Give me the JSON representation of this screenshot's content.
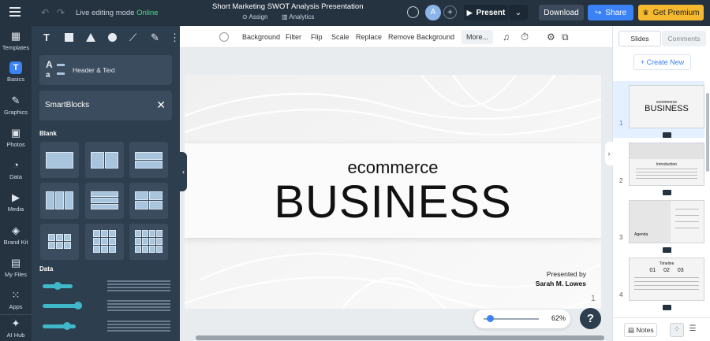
{
  "topbar": {
    "undo_icon": "undo-icon",
    "redo_icon": "redo-icon",
    "edit_mode_label": "Live editing mode",
    "edit_mode_status": "Online",
    "doc_title": "Short Marketing SWOT Analysis Presentation",
    "assign_label": "Assign",
    "analytics_label": "Analytics",
    "avatar_letter": "A",
    "present_label": "Present",
    "download_label": "Download",
    "share_label": "Share",
    "premium_label": "Get Premium",
    "accent": "#3b82f6",
    "premium_color": "#f5b82e"
  },
  "leftnav": {
    "items": [
      {
        "label": "Templates",
        "icon": "templates-icon"
      },
      {
        "label": "Basics",
        "icon": "text-icon",
        "active": true
      },
      {
        "label": "Graphics",
        "icon": "graphics-icon"
      },
      {
        "label": "Photos",
        "icon": "photos-icon"
      },
      {
        "label": "Data",
        "icon": "data-icon"
      },
      {
        "label": "Media",
        "icon": "media-icon"
      },
      {
        "label": "Brand Kit",
        "icon": "brand-kit-icon"
      },
      {
        "label": "My Files",
        "icon": "my-files-icon"
      },
      {
        "label": "Apps",
        "icon": "apps-icon"
      },
      {
        "label": "AI Hub",
        "icon": "ai-hub-icon"
      }
    ]
  },
  "panel": {
    "header_text_label": "Header & Text",
    "smartblocks_label": "SmartBlocks",
    "blank_title": "Blank",
    "data_title": "Data"
  },
  "canvas_toolbar": {
    "items": [
      "Background",
      "Filter",
      "Flip",
      "Scale",
      "Replace",
      "Remove Background"
    ],
    "more_label": "More..."
  },
  "slide": {
    "subtitle": "ecommerce",
    "title": "BUSINESS",
    "presented_by": "Presented by",
    "presenter": "Sarah M. Lowes",
    "page_number": "1"
  },
  "zoom": {
    "value": "62%",
    "level_fraction": 0.05
  },
  "help_label": "?",
  "right_panel": {
    "tab_slides": "Slides",
    "tab_comments": "Comments",
    "create_new": "+ Create New",
    "thumbs": [
      {
        "num": "1",
        "line1": "ecommerce",
        "line2": "BUSINESS"
      },
      {
        "num": "2",
        "line1": "Introduction",
        "line2": ""
      },
      {
        "num": "3",
        "line1": "Agenda",
        "line2": ""
      },
      {
        "num": "4",
        "line1": "Timeline",
        "line2": "01  02  03"
      }
    ],
    "notes_label": "Notes"
  }
}
